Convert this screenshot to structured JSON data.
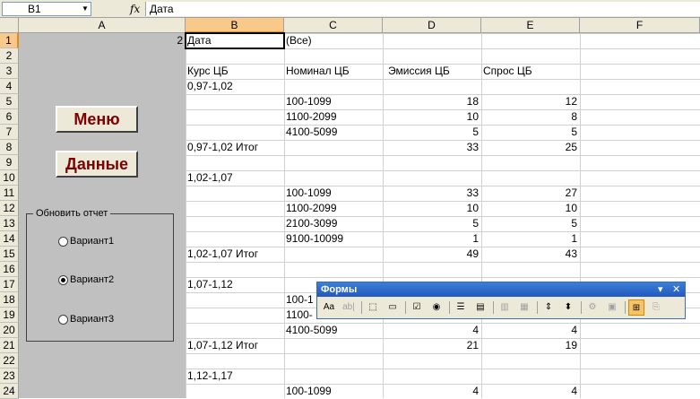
{
  "formula_bar": {
    "cell_ref": "B1",
    "fx_label": "fx",
    "content": "Дата"
  },
  "columns": [
    "A",
    "B",
    "C",
    "D",
    "E",
    "F"
  ],
  "rows": [
    "1",
    "2",
    "3",
    "4",
    "5",
    "6",
    "7",
    "8",
    "9",
    "10",
    "11",
    "12",
    "13",
    "14",
    "15",
    "16",
    "17",
    "18",
    "19",
    "20",
    "21",
    "22",
    "23",
    "24"
  ],
  "sheet": {
    "a1_value": "2",
    "filter": {
      "label": "Дата",
      "value": "(Все)"
    },
    "headers": {
      "kurs": "Курс ЦБ",
      "nominal": "Номинал ЦБ",
      "emissiya": "Эмиссия ЦБ",
      "spros": "Спрос ЦБ"
    },
    "table_rows": [
      {
        "row": 4,
        "b": "0,97-1,02",
        "c": "",
        "d": "",
        "e": ""
      },
      {
        "row": 5,
        "b": "",
        "c": "100-1099",
        "d": "18",
        "e": "12"
      },
      {
        "row": 6,
        "b": "",
        "c": "1100-2099",
        "d": "10",
        "e": "8"
      },
      {
        "row": 7,
        "b": "",
        "c": "4100-5099",
        "d": "5",
        "e": "5"
      },
      {
        "row": 8,
        "b": "0,97-1,02 Итог",
        "c": "",
        "d": "33",
        "e": "25"
      },
      {
        "row": 10,
        "b": "1,02-1,07",
        "c": "",
        "d": "",
        "e": ""
      },
      {
        "row": 11,
        "b": "",
        "c": "100-1099",
        "d": "33",
        "e": "27"
      },
      {
        "row": 12,
        "b": "",
        "c": "1100-2099",
        "d": "10",
        "e": "10"
      },
      {
        "row": 13,
        "b": "",
        "c": "2100-3099",
        "d": "5",
        "e": "5"
      },
      {
        "row": 14,
        "b": "",
        "c": "9100-10099",
        "d": "1",
        "e": "1"
      },
      {
        "row": 15,
        "b": "1,02-1,07 Итог",
        "c": "",
        "d": "49",
        "e": "43"
      },
      {
        "row": 17,
        "b": "1,07-1,12",
        "c": "",
        "d": "",
        "e": ""
      },
      {
        "row": 18,
        "b": "",
        "c": "100-1",
        "d": "",
        "e": ""
      },
      {
        "row": 19,
        "b": "",
        "c": "1100-",
        "d": "",
        "e": ""
      },
      {
        "row": 20,
        "b": "",
        "c": "4100-5099",
        "d": "4",
        "e": "4"
      },
      {
        "row": 21,
        "b": "1,07-1,12 Итог",
        "c": "",
        "d": "21",
        "e": "19"
      },
      {
        "row": 23,
        "b": "1,12-1,17",
        "c": "",
        "d": "",
        "e": ""
      },
      {
        "row": 24,
        "b": "",
        "c": "100-1099",
        "d": "4",
        "e": "4"
      }
    ]
  },
  "buttons": {
    "menu": "Меню",
    "data": "Данные"
  },
  "group": {
    "title": "Обновить отчет",
    "options": [
      {
        "label": "Вариант1",
        "checked": false
      },
      {
        "label": "Вариант2",
        "checked": true
      },
      {
        "label": "Вариант3",
        "checked": false
      }
    ]
  },
  "toolbar": {
    "title": "Формы",
    "close_glyph": "✕",
    "dropdown_glyph": "▾",
    "tools": [
      {
        "name": "label-tool",
        "glyph": "Aa",
        "dim": false
      },
      {
        "name": "editbox-tool",
        "glyph": "ab|",
        "dim": true
      },
      {
        "name": "groupbox-tool",
        "glyph": "⬚",
        "dim": false
      },
      {
        "name": "button-tool",
        "glyph": "▭",
        "dim": false
      },
      {
        "name": "checkbox-tool",
        "glyph": "☑",
        "dim": false
      },
      {
        "name": "option-tool",
        "glyph": "◉",
        "dim": false
      },
      {
        "name": "listbox-tool",
        "glyph": "☰",
        "dim": false
      },
      {
        "name": "combobox-tool",
        "glyph": "▤",
        "dim": false
      },
      {
        "name": "combolist-tool",
        "glyph": "▥",
        "dim": true
      },
      {
        "name": "combodropdown-tool",
        "glyph": "▦",
        "dim": true
      },
      {
        "name": "scrollbar-tool",
        "glyph": "⇕",
        "dim": false
      },
      {
        "name": "spinner-tool",
        "glyph": "⬍",
        "dim": false
      },
      {
        "name": "properties-tool",
        "glyph": "⚙",
        "dim": true
      },
      {
        "name": "code-tool",
        "glyph": "▣",
        "dim": true
      },
      {
        "name": "grid-tool",
        "glyph": "⊞",
        "dim": false,
        "active": true
      },
      {
        "name": "run-dialog-tool",
        "glyph": "⎘",
        "dim": true
      }
    ]
  }
}
